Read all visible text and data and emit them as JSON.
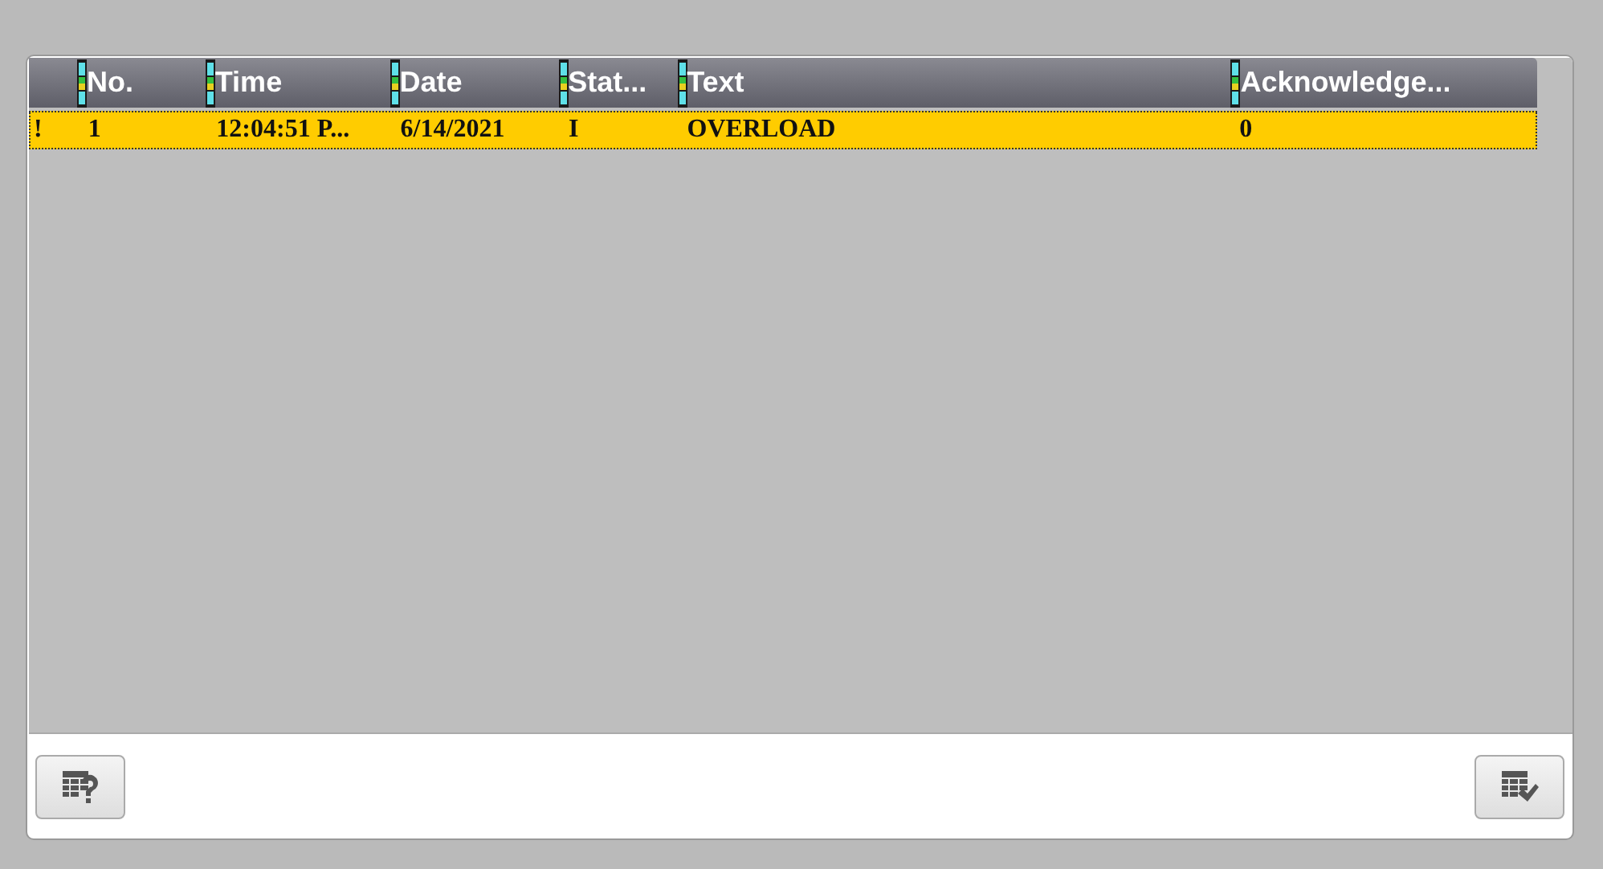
{
  "table": {
    "columns": [
      {
        "label": "No."
      },
      {
        "label": "Time"
      },
      {
        "label": "Date"
      },
      {
        "label": "Stat..."
      },
      {
        "label": "Text"
      },
      {
        "label": "Acknowledge..."
      }
    ],
    "rows": [
      {
        "selected": true,
        "marker": "!",
        "cells": [
          "1",
          "12:04:51 P...",
          "6/14/2021",
          "I",
          "OVERLOAD",
          "0"
        ]
      }
    ]
  }
}
